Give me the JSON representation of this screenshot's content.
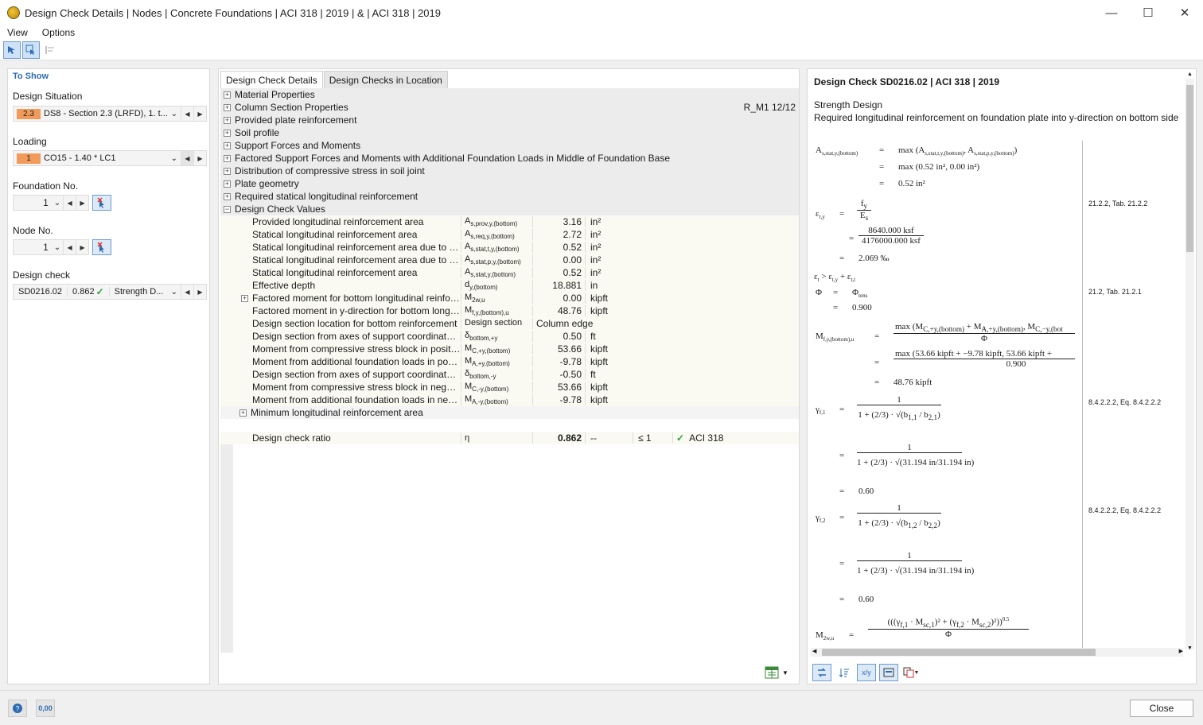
{
  "window": {
    "title": "Design Check Details | Nodes | Concrete Foundations | ACI 318 | 2019 | & | ACI 318 | 2019",
    "minimize": "—",
    "maximize": "☐",
    "close": "✕"
  },
  "menu": {
    "view": "View",
    "options": "Options"
  },
  "left": {
    "heading": "To Show",
    "design_situation_label": "Design Situation",
    "design_situation_badge": "2.3",
    "design_situation_value": "DS8 - Section 2.3 (LRFD), 1. t...",
    "loading_label": "Loading",
    "loading_badge": "1",
    "loading_value": "CO15 - 1.40 * LC1",
    "foundation_label": "Foundation No.",
    "foundation_value": "1",
    "node_label": "Node No.",
    "node_value": "1",
    "design_check_label": "Design check",
    "design_check_id": "SD0216.02",
    "design_check_ratio": "0.862",
    "design_check_type": "Strength D..."
  },
  "middle": {
    "tab_details": "Design Check Details",
    "tab_location": "Design Checks in Location",
    "sections": [
      {
        "label": "Material Properties",
        "extra": ""
      },
      {
        "label": "Column Section Properties",
        "extra": "R_M1 12/12"
      },
      {
        "label": "Provided plate reinforcement",
        "extra": ""
      },
      {
        "label": "Soil profile",
        "extra": ""
      },
      {
        "label": "Support Forces and Moments",
        "extra": ""
      },
      {
        "label": "Factored Support Forces and Moments with Additional Foundation Loads in Middle of Foundation Base",
        "extra": ""
      },
      {
        "label": "Distribution of compressive stress in soil joint",
        "extra": ""
      },
      {
        "label": "Plate geometry",
        "extra": ""
      },
      {
        "label": "Required statical longitudinal reinforcement",
        "extra": ""
      },
      {
        "label": "Design Check Values",
        "extra": ""
      }
    ],
    "rows": [
      {
        "desc": "Provided longitudinal reinforcement area",
        "sym": "A",
        "sub": "s,prov,y,(bottom)",
        "val": "3.16",
        "unit": "in²"
      },
      {
        "desc": "Statical longitudinal reinforcement area",
        "sym": "A",
        "sub": "s,req,y,(bottom)",
        "val": "2.72",
        "unit": "in²"
      },
      {
        "desc": "Statical longitudinal reinforcement area due to tens...",
        "sym": "A",
        "sub": "s,stat,t,y,(bottom)",
        "val": "0.52",
        "unit": "in²"
      },
      {
        "desc": "Statical longitudinal reinforcement area due to pres...",
        "sym": "A",
        "sub": "s,stat,p,y,(bottom)",
        "val": "0.00",
        "unit": "in²"
      },
      {
        "desc": "Statical longitudinal reinforcement area",
        "sym": "A",
        "sub": "s,stat,y,(bottom)",
        "val": "0.52",
        "unit": "in²"
      },
      {
        "desc": "Effective depth",
        "sym": "d",
        "sub": "y,(bottom)",
        "val": "18.881",
        "unit": "in"
      },
      {
        "desc": "Factored moment for bottom longitudinal reinforce...",
        "sym": "M",
        "sub": "2w,u",
        "val": "0.00",
        "unit": "kipft"
      },
      {
        "desc": "Factored moment in y-direction for bottom longitu...",
        "sym": "M",
        "sub": "f,y,(bottom),u",
        "val": "48.76",
        "unit": "kipft"
      },
      {
        "desc": "Design section location for bottom reinforcement",
        "sym": "Design section",
        "sub": "",
        "val": "Column edge",
        "unit": ""
      },
      {
        "desc": "Design section from axes of support coordinate syst...",
        "sym": "δ",
        "sub": "bottom,+y",
        "val": "0.50",
        "unit": "ft"
      },
      {
        "desc": "Moment from compressive stress block in positive y-...",
        "sym": "M",
        "sub": "C,+y,(bottom)",
        "val": "53.66",
        "unit": "kipft"
      },
      {
        "desc": "Moment from additional foundation loads in positi...",
        "sym": "M",
        "sub": "A,+y,(bottom)",
        "val": "-9.78",
        "unit": "kipft"
      },
      {
        "desc": "Design section from axes of support coordinate syst...",
        "sym": "δ",
        "sub": "bottom,-y",
        "val": "-0.50",
        "unit": "ft"
      },
      {
        "desc": "Moment from compressive stress block in negative y...",
        "sym": "M",
        "sub": "C,-y,(bottom)",
        "val": "53.66",
        "unit": "kipft"
      },
      {
        "desc": "Moment from additional foundation loads in negat...",
        "sym": "M",
        "sub": "A,-y,(bottom)",
        "val": "-9.78",
        "unit": "kipft"
      }
    ],
    "min_section": "Minimum longitudinal reinforcement area",
    "ratio": {
      "desc": "Design check ratio",
      "sym": "η",
      "val": "0.862",
      "unit": "--",
      "cmp": "≤ 1",
      "ref": "ACI 318"
    }
  },
  "right": {
    "title": "Design Check SD0216.02 | ACI 318 | 2019",
    "subtitle": "Strength Design",
    "description": "Required longitudinal reinforcement on foundation plate into y-direction on bottom side",
    "refs": {
      "r1": "21.2.2, Tab. 21.2.2",
      "r2": "21.2, Tab. 21.2.1",
      "r3": "8.4.2.2.2, Eq. 8.4.2.2.2",
      "r4": "8.4.2.2.2, Eq. 8.4.2.2.2"
    },
    "values": {
      "as_line2": "max (0.52 in², 0.00 in²)",
      "as_result": "0.52 in²",
      "fy_num": "8640.000 ksf",
      "es_den": "4176000.000 ksf",
      "eps_result": "2.069 ‰",
      "phi_result": "0.900",
      "m_num2": "max (53.66 kipft + −9.78 kipft, 53.66 kipft +",
      "m_den2": "0.900",
      "m_result": "48.76 kipft",
      "gamma1_result": "0.60",
      "gamma2_result": "0.60",
      "b_value": "31.194 in",
      "m2w_exp": "0.5"
    }
  },
  "footer": {
    "close": "Close",
    "units_btn": "0,00"
  }
}
